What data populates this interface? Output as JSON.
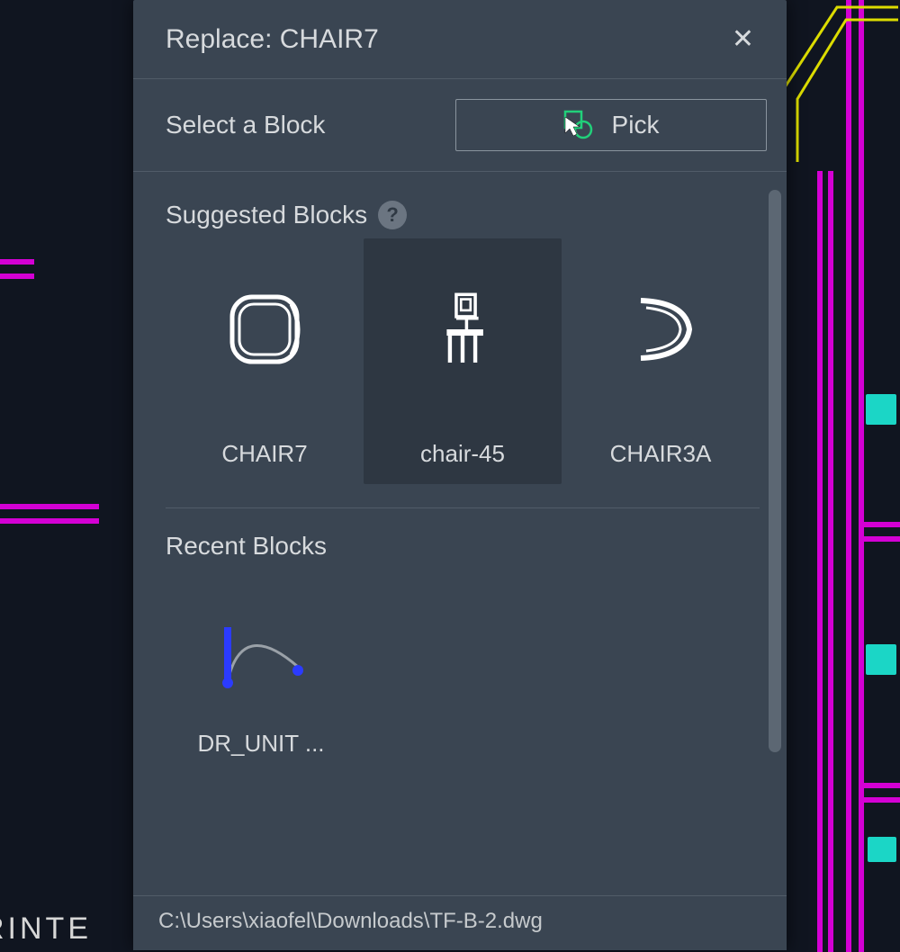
{
  "panel": {
    "title": "Replace: CHAIR7",
    "select_label": "Select a Block",
    "pick_label": "Pick",
    "suggested_title": "Suggested Blocks",
    "recent_title": "Recent Blocks",
    "footer_path": "C:\\Users\\xiaofel\\Downloads\\TF-B-2.dwg",
    "suggested": [
      {
        "label": "CHAIR7"
      },
      {
        "label": "chair-45"
      },
      {
        "label": "CHAIR3A"
      }
    ],
    "recent": [
      {
        "label": "DR_UNIT ..."
      }
    ]
  },
  "canvas": {
    "bottom_text": "RINTE"
  },
  "colors": {
    "panel_bg": "#3a4552",
    "canvas_bg": "#101520",
    "magenta": "#d400d4",
    "yellow": "#dcdc00",
    "teal": "#1bd6c6",
    "blue": "#2b3bff"
  }
}
